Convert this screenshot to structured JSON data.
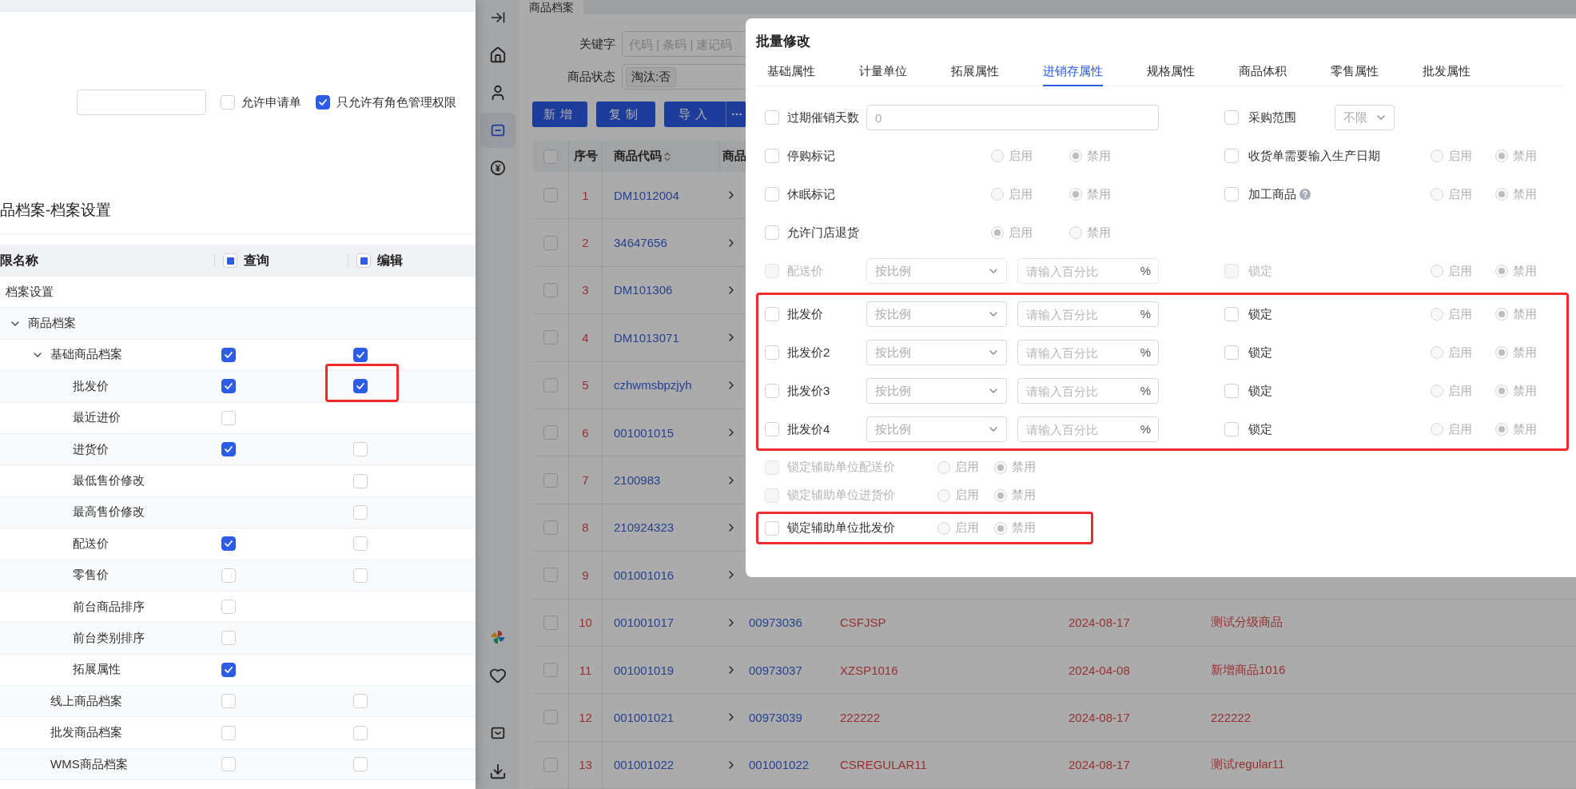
{
  "left_panel": {
    "options": [
      {
        "label": "允许申请单",
        "checked": false
      },
      {
        "label": "只允许有角色管理权限",
        "checked": true
      }
    ],
    "title": "品档案-档案设置",
    "columns": [
      {
        "label": "限名称"
      },
      {
        "label": "查询",
        "indeterminate": true
      },
      {
        "label": "编辑",
        "indeterminate": true
      }
    ],
    "rows": [
      {
        "name": "档案设置",
        "children": [
          {
            "name": "商品档案",
            "expanded": true,
            "children": [
              {
                "name": "基础商品档案",
                "expanded": true,
                "query": true,
                "edit": true,
                "children": [
                  {
                    "name": "批发价",
                    "query": true,
                    "edit": true,
                    "edit_highlighted": true
                  },
                  {
                    "name": "最近进价",
                    "query": false
                  },
                  {
                    "name": "进货价",
                    "query": true,
                    "edit": false
                  },
                  {
                    "name": "最低售价修改",
                    "edit": false
                  },
                  {
                    "name": "最高售价修改",
                    "edit": false
                  },
                  {
                    "name": "配送价",
                    "query": true,
                    "edit": false
                  },
                  {
                    "name": "零售价",
                    "query": false,
                    "edit": false
                  },
                  {
                    "name": "前台商品排序",
                    "query": false
                  },
                  {
                    "name": "前台类别排序",
                    "query": false
                  },
                  {
                    "name": "拓展属性",
                    "query": true
                  }
                ]
              },
              {
                "name": "线上商品档案",
                "query": false,
                "edit": false
              },
              {
                "name": "批发商品档案",
                "query": false,
                "edit": false
              },
              {
                "name": "WMS商品档案",
                "query": false,
                "edit": false
              }
            ]
          }
        ]
      }
    ]
  },
  "app": {
    "sidebar": [
      {
        "selected": false
      },
      {
        "selected": false
      },
      {
        "selected": false
      },
      {
        "selected": true
      },
      {
        "selected": false
      },
      {
        "selected": false
      },
      {
        "selected": false
      },
      {
        "selected": false
      },
      {
        "selected": false
      }
    ],
    "tab": "商品档案",
    "keyword": {
      "label": "关键字",
      "placeholder": "代码 | 条码 | 速记码"
    },
    "status": {
      "label": "商品状态",
      "tag": "淘汰:否"
    },
    "buttons": [
      "新增",
      "复制",
      "导入"
    ],
    "table": {
      "all_checked": false,
      "columns": [
        "序号",
        "商品代码",
        "商品"
      ],
      "rows": [
        {
          "index": "1",
          "checked": false,
          "code": "DM1012004"
        },
        {
          "index": "2",
          "checked": false,
          "code": "34647656"
        },
        {
          "index": "3",
          "checked": false,
          "code": "DM101306"
        },
        {
          "index": "4",
          "checked": false,
          "code": "DM1013071"
        },
        {
          "index": "5",
          "checked": false,
          "code": "czhwmsbpzjyh"
        },
        {
          "index": "6",
          "checked": false,
          "code": "001001015"
        },
        {
          "index": "7",
          "checked": false,
          "code": "2100983"
        },
        {
          "index": "8",
          "checked": false,
          "code": "210924323"
        },
        {
          "index": "9",
          "checked": false,
          "code": "001001016"
        },
        {
          "index": "10",
          "checked": false,
          "code": "001001017",
          "barcode": "00973036",
          "short": "CSFJSP",
          "date": "2024-08-17",
          "name": "测试分级商品"
        },
        {
          "index": "11",
          "checked": false,
          "code": "001001019",
          "barcode": "00973037",
          "short": "XZSP1016",
          "date": "2024-04-08",
          "name": "新增商品1016"
        },
        {
          "index": "12",
          "checked": false,
          "code": "001001021",
          "barcode": "00973039",
          "short": "222222",
          "date": "2024-08-17",
          "name": "222222"
        },
        {
          "index": "13",
          "checked": false,
          "code": "001001022",
          "barcode": "001001022",
          "short": "CSREGULAR11",
          "date": "2024-08-17",
          "name": "测试regular11"
        }
      ]
    }
  },
  "dialog": {
    "title": "批量修改",
    "tabs": [
      {
        "label": "基础属性",
        "selected": false
      },
      {
        "label": "计量单位",
        "selected": false
      },
      {
        "label": "拓展属性",
        "selected": false
      },
      {
        "label": "进销存属性",
        "selected": true
      },
      {
        "label": "规格属性",
        "selected": false
      },
      {
        "label": "商品体积",
        "selected": false
      },
      {
        "label": "零售属性",
        "selected": false
      },
      {
        "label": "批发属性",
        "selected": false
      }
    ],
    "sections": [
      {
        "highlighted": false,
        "rows": [
          {
            "left": {
              "kind": "number",
              "label": "过期催销天数",
              "checked": false,
              "disabled": false,
              "value": "0"
            },
            "right": {
              "kind": "select",
              "label": "采购范围",
              "checked": false,
              "disabled": false,
              "value": "不限"
            }
          },
          {
            "left": {
              "kind": "radio",
              "label": "停购标记",
              "checked": false,
              "disabled": false,
              "options": [
                {
                  "label": "启用",
                  "selected": false
                },
                {
                  "label": "禁用",
                  "selected": true
                }
              ]
            },
            "right": {
              "kind": "radio",
              "label": "收货单需要输入生产日期",
              "checked": false,
              "disabled": false,
              "options": [
                {
                  "label": "启用",
                  "selected": false
                },
                {
                  "label": "禁用",
                  "selected": true
                }
              ]
            }
          },
          {
            "left": {
              "kind": "radio",
              "label": "休眠标记",
              "checked": false,
              "disabled": false,
              "options": [
                {
                  "label": "启用",
                  "selected": false
                },
                {
                  "label": "禁用",
                  "selected": true
                }
              ]
            },
            "right": {
              "kind": "radio",
              "label": "加工商品",
              "help": true,
              "checked": false,
              "disabled": false,
              "options": [
                {
                  "label": "启用",
                  "selected": false
                },
                {
                  "label": "禁用",
                  "selected": true
                }
              ]
            }
          },
          {
            "left": {
              "kind": "radio",
              "label": "允许门店退货",
              "checked": false,
              "disabled": false,
              "options": [
                {
                  "label": "启用",
                  "selected": true
                },
                {
                  "label": "禁用",
                  "selected": false
                }
              ]
            }
          },
          {
            "left": {
              "kind": "price",
              "label": "配送价",
              "checked": false,
              "disabled": true,
              "mode": "按比例",
              "placeholder": "请输入百分比",
              "unit": "%"
            },
            "right": {
              "kind": "radio",
              "label": "锁定",
              "checked": false,
              "disabled": true,
              "options": [
                {
                  "label": "启用",
                  "selected": false
                },
                {
                  "label": "禁用",
                  "selected": true
                }
              ]
            }
          }
        ]
      },
      {
        "highlighted": true,
        "rows": [
          {
            "left": {
              "kind": "price",
              "label": "批发价",
              "checked": false,
              "disabled": false,
              "mode": "按比例",
              "placeholder": "请输入百分比",
              "unit": "%"
            },
            "right": {
              "kind": "radio",
              "label": "锁定",
              "checked": false,
              "disabled": false,
              "options": [
                {
                  "label": "启用",
                  "selected": false
                },
                {
                  "label": "禁用",
                  "selected": true
                }
              ]
            }
          },
          {
            "left": {
              "kind": "price",
              "label": "批发价2",
              "checked": false,
              "disabled": false,
              "mode": "按比例",
              "placeholder": "请输入百分比",
              "unit": "%"
            },
            "right": {
              "kind": "radio",
              "label": "锁定",
              "checked": false,
              "disabled": false,
              "options": [
                {
                  "label": "启用",
                  "selected": false
                },
                {
                  "label": "禁用",
                  "selected": true
                }
              ]
            }
          },
          {
            "left": {
              "kind": "price",
              "label": "批发价3",
              "checked": false,
              "disabled": false,
              "mode": "按比例",
              "placeholder": "请输入百分比",
              "unit": "%"
            },
            "right": {
              "kind": "radio",
              "label": "锁定",
              "checked": false,
              "disabled": false,
              "options": [
                {
                  "label": "启用",
                  "selected": false
                },
                {
                  "label": "禁用",
                  "selected": true
                }
              ]
            }
          },
          {
            "left": {
              "kind": "price",
              "label": "批发价4",
              "checked": false,
              "disabled": false,
              "mode": "按比例",
              "placeholder": "请输入百分比",
              "unit": "%"
            },
            "right": {
              "kind": "radio",
              "label": "锁定",
              "checked": false,
              "disabled": false,
              "options": [
                {
                  "label": "启用",
                  "selected": false
                },
                {
                  "label": "禁用",
                  "selected": true
                }
              ]
            }
          }
        ]
      },
      {
        "highlighted": false,
        "rows": [
          {
            "left": {
              "kind": "radio_wide",
              "label": "锁定辅助单位配送价",
              "checked": false,
              "disabled": true,
              "options": [
                {
                  "label": "启用",
                  "selected": false
                },
                {
                  "label": "禁用",
                  "selected": true
                }
              ]
            }
          },
          {
            "left": {
              "kind": "radio_wide",
              "label": "锁定辅助单位进货价",
              "checked": false,
              "disabled": true,
              "options": [
                {
                  "label": "启用",
                  "selected": false
                },
                {
                  "label": "禁用",
                  "selected": true
                }
              ]
            }
          }
        ]
      },
      {
        "highlighted": true,
        "rows": [
          {
            "left": {
              "kind": "radio_wide",
              "label": "锁定辅助单位批发价",
              "checked": false,
              "disabled": false,
              "options": [
                {
                  "label": "启用",
                  "selected": false
                },
                {
                  "label": "禁用",
                  "selected": true
                }
              ]
            }
          }
        ]
      }
    ]
  }
}
